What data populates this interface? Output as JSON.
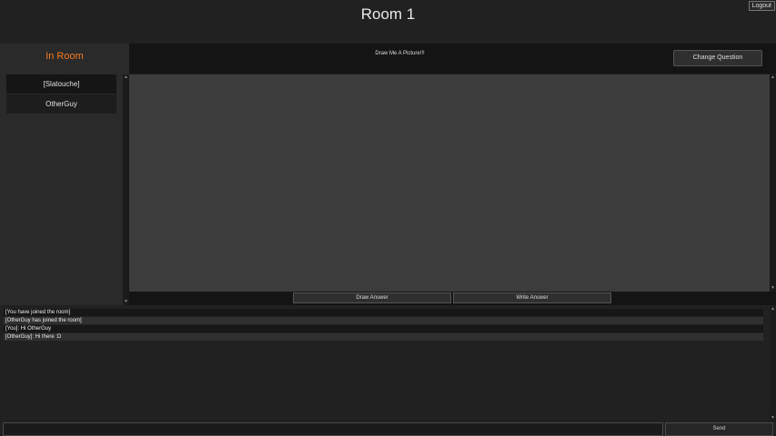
{
  "header": {
    "title": "Room 1",
    "logout_label": "Logout"
  },
  "sidebar": {
    "heading": "In Room",
    "users": [
      "[Slatouche]",
      "OtherGuy"
    ]
  },
  "canvas_panel": {
    "question": "Draw Me A Picture!!!",
    "change_question_label": "Change Question",
    "draw_answer_label": "Draw Answer",
    "write_answer_label": "Write Answer"
  },
  "chat": {
    "messages": [
      "[You have joined the room]",
      "[OtherGuy has joined the room]",
      "[You]: Hi OtherGuy",
      "[OtherGuy]: Hi there :D"
    ],
    "input_value": "",
    "send_label": "Send"
  },
  "colors": {
    "accent": "#f47b20",
    "background": "#212121",
    "canvas": "#3c3c3c"
  },
  "icons": {
    "scroll_up": "triangle-up-icon",
    "scroll_down": "triangle-down-icon"
  }
}
